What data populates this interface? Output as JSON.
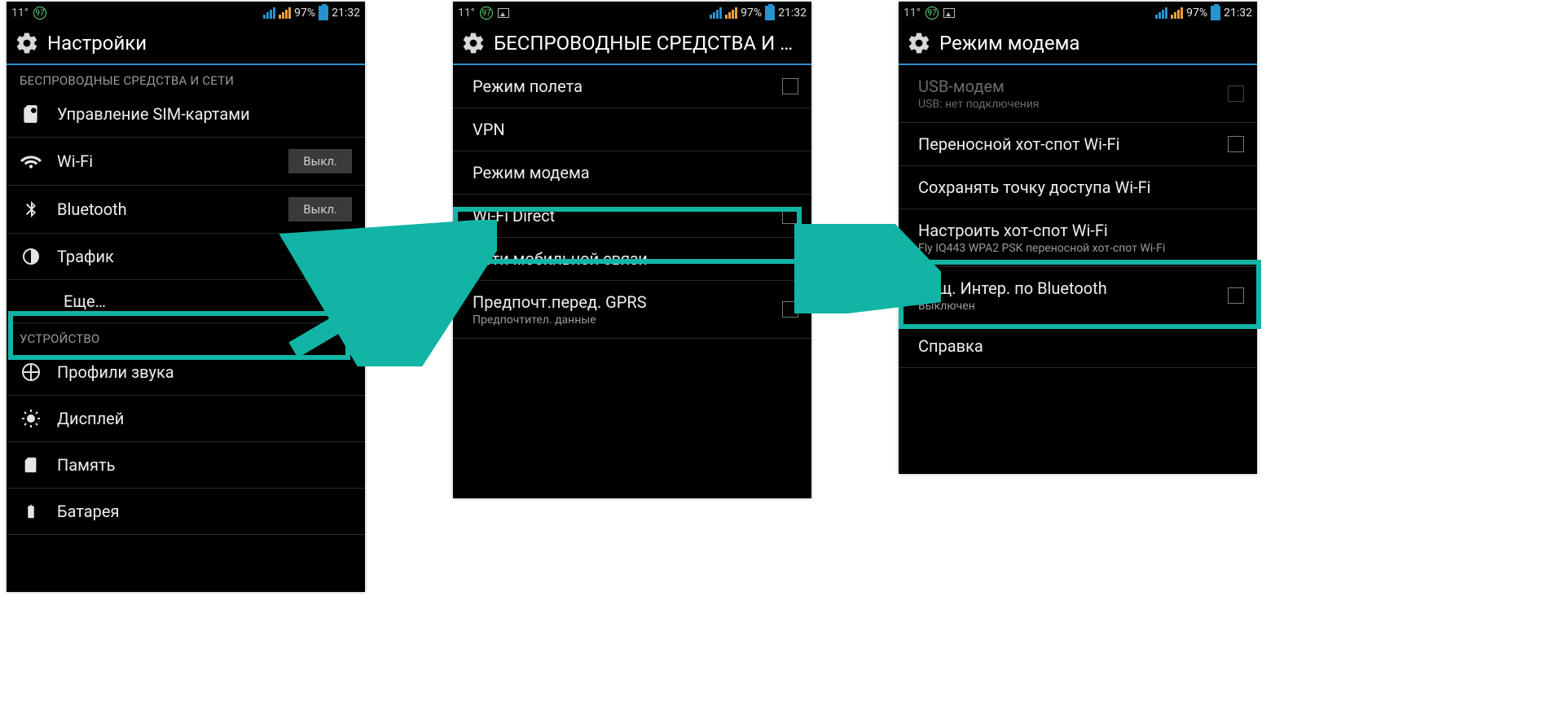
{
  "status": {
    "temp": "11°",
    "badge": "97",
    "battery_pct": "97%",
    "time": "21:32"
  },
  "screen1": {
    "title": "Настройки",
    "section_wireless": "БЕСПРОВОДНЫЕ СРЕДСТВА И СЕТИ",
    "sim": "Управление SIM-картами",
    "wifi": "Wi-Fi",
    "wifi_state": "Выкл.",
    "bluetooth": "Bluetooth",
    "bluetooth_state": "Выкл.",
    "traffic": "Трафик",
    "more": "Еще…",
    "section_device": "УСТРОЙСТВО",
    "audio": "Профили звука",
    "display": "Дисплей",
    "memory": "Память",
    "battery": "Батарея"
  },
  "screen2": {
    "title": "БЕСПРОВОДНЫЕ СРЕДСТВА И СЕ…",
    "airplane": "Режим полета",
    "vpn": "VPN",
    "tether": "Режим модема",
    "wifi_direct": "Wi-Fi Direct",
    "mobile": "Сети мобильной связи",
    "gprs": "Предпочт.перед. GPRS",
    "gprs_sub": "Предпочтител. данные"
  },
  "screen3": {
    "title": "Режим модема",
    "usb": "USB-модем",
    "usb_sub": "USB: нет подключения",
    "hotspot": "Переносной хот-спот Wi-Fi",
    "keep": "Сохранять точку доступа Wi-Fi",
    "configure": "Настроить хот-спот Wi-Fi",
    "configure_sub": "Fly IQ443 WPA2 PSK переносной хот-спот Wi-Fi",
    "bt_share": "Общ. Интер. по Bluetooth",
    "bt_share_sub": "Выключен",
    "help": "Справка"
  }
}
